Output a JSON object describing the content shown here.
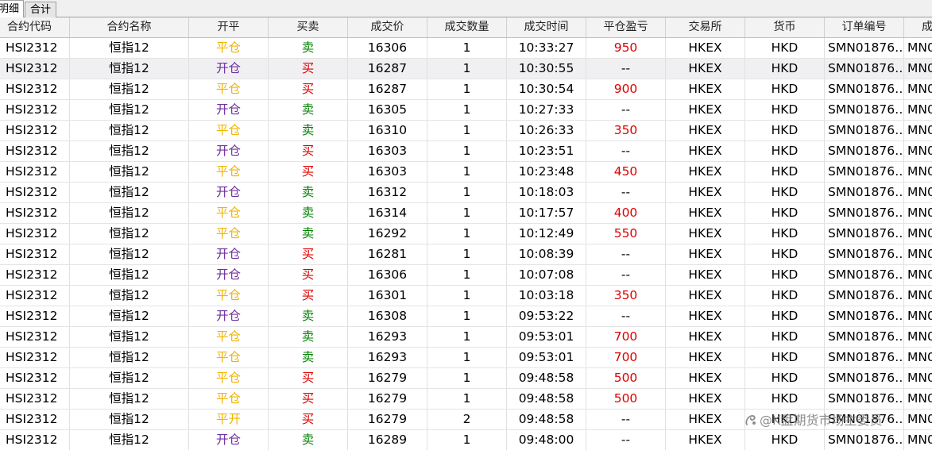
{
  "tabs": [
    {
      "label": "明细",
      "active": true
    },
    {
      "label": "合计",
      "active": false
    }
  ],
  "columns": [
    "合约代码",
    "合约名称",
    "开平",
    "买卖",
    "成交价",
    "成交数量",
    "成交时间",
    "平仓盈亏",
    "交易所",
    "货币",
    "订单编号",
    "成"
  ],
  "rows": [
    {
      "code": "HSI2312",
      "name": "恒指12",
      "oc": "平仓",
      "bs": "卖",
      "price": "16306",
      "qty": "1",
      "time": "10:33:27",
      "pnl": "950",
      "exch": "HKEX",
      "cur": "HKD",
      "order": "SMN01876…",
      "extra": "MN0"
    },
    {
      "code": "HSI2312",
      "name": "恒指12",
      "oc": "开仓",
      "bs": "买",
      "price": "16287",
      "qty": "1",
      "time": "10:30:55",
      "pnl": "--",
      "exch": "HKEX",
      "cur": "HKD",
      "order": "SMN01876…",
      "extra": "MN0"
    },
    {
      "code": "HSI2312",
      "name": "恒指12",
      "oc": "平仓",
      "bs": "买",
      "price": "16287",
      "qty": "1",
      "time": "10:30:54",
      "pnl": "900",
      "exch": "HKEX",
      "cur": "HKD",
      "order": "SMN01876…",
      "extra": "MN0"
    },
    {
      "code": "HSI2312",
      "name": "恒指12",
      "oc": "开仓",
      "bs": "卖",
      "price": "16305",
      "qty": "1",
      "time": "10:27:33",
      "pnl": "--",
      "exch": "HKEX",
      "cur": "HKD",
      "order": "SMN01876…",
      "extra": "MN0"
    },
    {
      "code": "HSI2312",
      "name": "恒指12",
      "oc": "平仓",
      "bs": "卖",
      "price": "16310",
      "qty": "1",
      "time": "10:26:33",
      "pnl": "350",
      "exch": "HKEX",
      "cur": "HKD",
      "order": "SMN01876…",
      "extra": "MN0"
    },
    {
      "code": "HSI2312",
      "name": "恒指12",
      "oc": "开仓",
      "bs": "买",
      "price": "16303",
      "qty": "1",
      "time": "10:23:51",
      "pnl": "--",
      "exch": "HKEX",
      "cur": "HKD",
      "order": "SMN01876…",
      "extra": "MN0"
    },
    {
      "code": "HSI2312",
      "name": "恒指12",
      "oc": "平仓",
      "bs": "买",
      "price": "16303",
      "qty": "1",
      "time": "10:23:48",
      "pnl": "450",
      "exch": "HKEX",
      "cur": "HKD",
      "order": "SMN01876…",
      "extra": "MN0"
    },
    {
      "code": "HSI2312",
      "name": "恒指12",
      "oc": "开仓",
      "bs": "卖",
      "price": "16312",
      "qty": "1",
      "time": "10:18:03",
      "pnl": "--",
      "exch": "HKEX",
      "cur": "HKD",
      "order": "SMN01876…",
      "extra": "MN0"
    },
    {
      "code": "HSI2312",
      "name": "恒指12",
      "oc": "平仓",
      "bs": "卖",
      "price": "16314",
      "qty": "1",
      "time": "10:17:57",
      "pnl": "400",
      "exch": "HKEX",
      "cur": "HKD",
      "order": "SMN01876…",
      "extra": "MN0"
    },
    {
      "code": "HSI2312",
      "name": "恒指12",
      "oc": "平仓",
      "bs": "卖",
      "price": "16292",
      "qty": "1",
      "time": "10:12:49",
      "pnl": "550",
      "exch": "HKEX",
      "cur": "HKD",
      "order": "SMN01876…",
      "extra": "MN0"
    },
    {
      "code": "HSI2312",
      "name": "恒指12",
      "oc": "开仓",
      "bs": "买",
      "price": "16281",
      "qty": "1",
      "time": "10:08:39",
      "pnl": "--",
      "exch": "HKEX",
      "cur": "HKD",
      "order": "SMN01876…",
      "extra": "MN0"
    },
    {
      "code": "HSI2312",
      "name": "恒指12",
      "oc": "开仓",
      "bs": "买",
      "price": "16306",
      "qty": "1",
      "time": "10:07:08",
      "pnl": "--",
      "exch": "HKEX",
      "cur": "HKD",
      "order": "SMN01876…",
      "extra": "MN0"
    },
    {
      "code": "HSI2312",
      "name": "恒指12",
      "oc": "平仓",
      "bs": "买",
      "price": "16301",
      "qty": "1",
      "time": "10:03:18",
      "pnl": "350",
      "exch": "HKEX",
      "cur": "HKD",
      "order": "SMN01876…",
      "extra": "MN0"
    },
    {
      "code": "HSI2312",
      "name": "恒指12",
      "oc": "开仓",
      "bs": "卖",
      "price": "16308",
      "qty": "1",
      "time": "09:53:22",
      "pnl": "--",
      "exch": "HKEX",
      "cur": "HKD",
      "order": "SMN01876…",
      "extra": "MN0"
    },
    {
      "code": "HSI2312",
      "name": "恒指12",
      "oc": "平仓",
      "bs": "卖",
      "price": "16293",
      "qty": "1",
      "time": "09:53:01",
      "pnl": "700",
      "exch": "HKEX",
      "cur": "HKD",
      "order": "SMN01876…",
      "extra": "MN0"
    },
    {
      "code": "HSI2312",
      "name": "恒指12",
      "oc": "平仓",
      "bs": "卖",
      "price": "16293",
      "qty": "1",
      "time": "09:53:01",
      "pnl": "700",
      "exch": "HKEX",
      "cur": "HKD",
      "order": "SMN01876…",
      "extra": "MN0"
    },
    {
      "code": "HSI2312",
      "name": "恒指12",
      "oc": "平仓",
      "bs": "买",
      "price": "16279",
      "qty": "1",
      "time": "09:48:58",
      "pnl": "500",
      "exch": "HKEX",
      "cur": "HKD",
      "order": "SMN01876…",
      "extra": "MN0"
    },
    {
      "code": "HSI2312",
      "name": "恒指12",
      "oc": "平仓",
      "bs": "买",
      "price": "16279",
      "qty": "1",
      "time": "09:48:58",
      "pnl": "500",
      "exch": "HKEX",
      "cur": "HKD",
      "order": "SMN01876…",
      "extra": "MN0"
    },
    {
      "code": "HSI2312",
      "name": "恒指12",
      "oc": "平开",
      "bs": "买",
      "price": "16279",
      "qty": "2",
      "time": "09:48:58",
      "pnl": "--",
      "exch": "HKEX",
      "cur": "HKD",
      "order": "SMN01876…",
      "extra": "MN0"
    },
    {
      "code": "HSI2312",
      "name": "恒指12",
      "oc": "开仓",
      "bs": "卖",
      "price": "16289",
      "qty": "1",
      "time": "09:48:00",
      "pnl": "--",
      "exch": "HKEX",
      "cur": "HKD",
      "order": "SMN01876…",
      "extra": "MN0"
    }
  ],
  "selected_row": 1,
  "colors": {
    "open": "#7030a0",
    "close": "#f0b400",
    "buy": "#e00000",
    "sell": "#008000",
    "profit": "#e00000"
  },
  "watermark": {
    "text": "@K盘期货市场主委员",
    "icon": "snowball-logo-icon"
  }
}
